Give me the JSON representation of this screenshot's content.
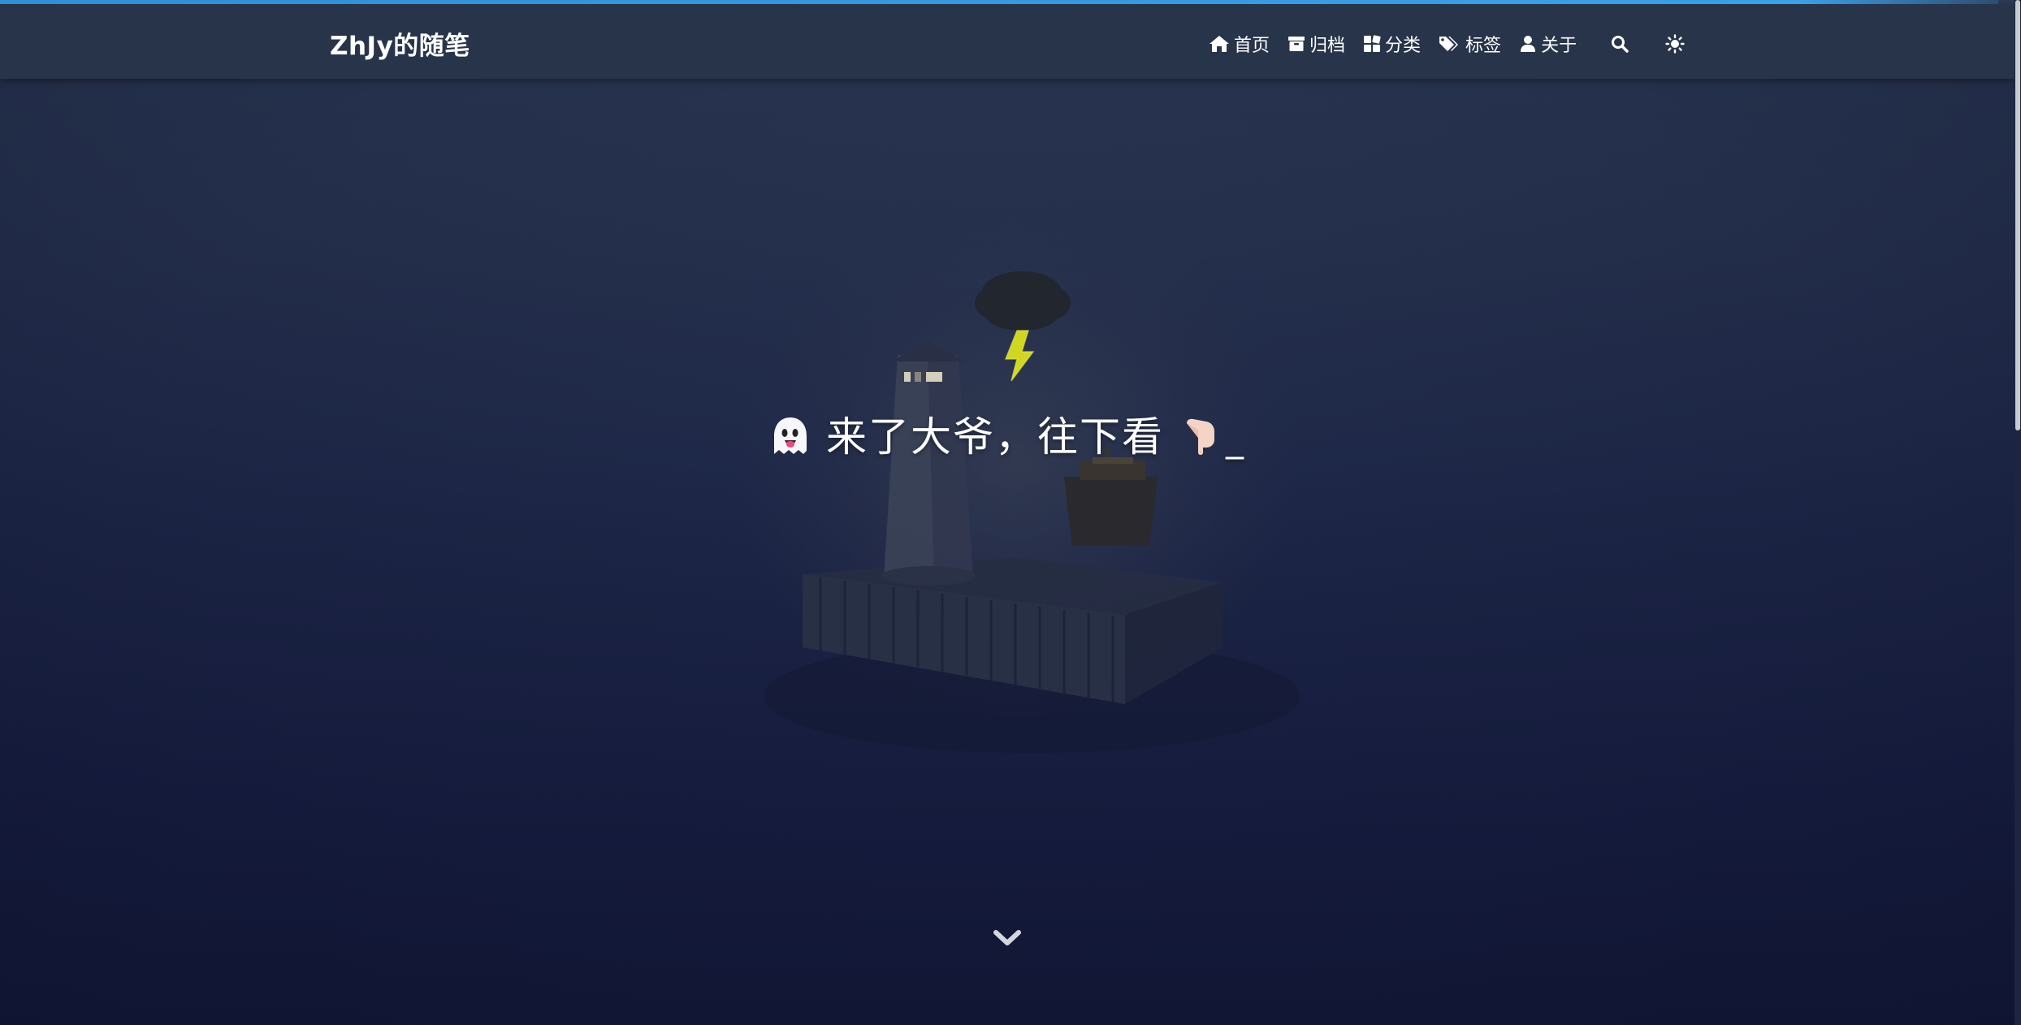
{
  "header": {
    "brand": "ZhJy的随笔",
    "nav": [
      {
        "label": "首页",
        "icon": "home-icon"
      },
      {
        "label": "归档",
        "icon": "archive-icon"
      },
      {
        "label": "分类",
        "icon": "category-icon"
      },
      {
        "label": "标签",
        "icon": "tags-icon"
      },
      {
        "label": "关于",
        "icon": "user-icon"
      }
    ],
    "search_icon": "search-icon",
    "theme_icon": "sun-icon"
  },
  "hero": {
    "text": "来了大爷，往下看",
    "cursor": "_",
    "leading_emoji": "ghost-icon",
    "trailing_emoji": "pointing-down-icon"
  },
  "scroll": {
    "icon": "chevron-down-icon"
  },
  "colors": {
    "accent": "#3ba0ea",
    "navbar_bg": "#28344a",
    "background_top": "#2c3a55",
    "background_bottom": "#131838",
    "lightning": "#d8dd22"
  }
}
